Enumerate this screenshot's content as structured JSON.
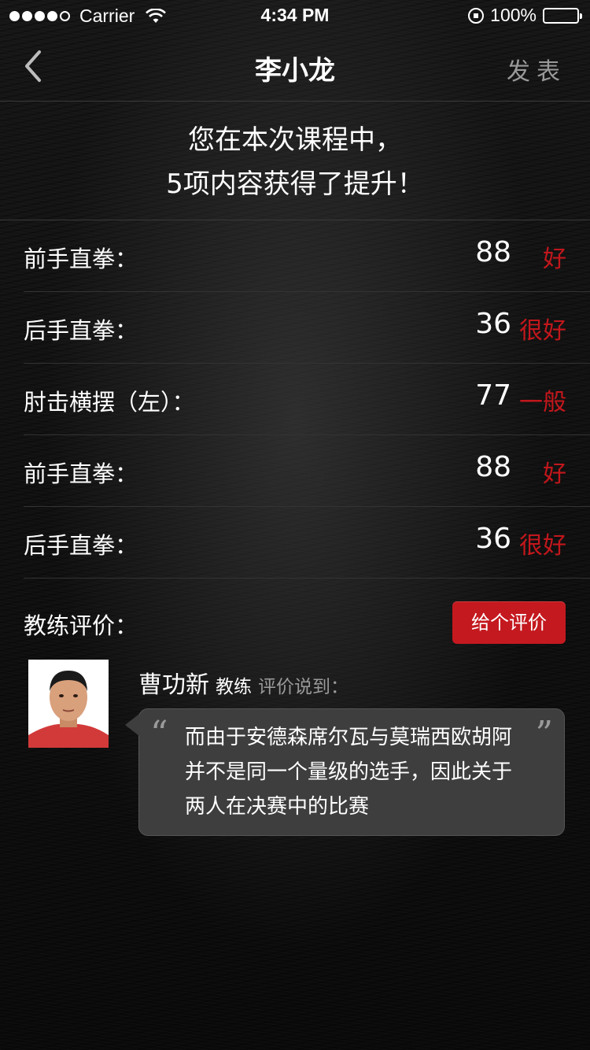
{
  "status_bar": {
    "carrier": "Carrier",
    "time": "4:34 PM",
    "battery": "100%"
  },
  "nav": {
    "title": "李小龙",
    "publish_label": "发表"
  },
  "summary": {
    "line1": "您在本次课程中，",
    "line2": "5项内容获得了提升！"
  },
  "scores": [
    {
      "label": "前手直拳：",
      "value": "88",
      "grade": "好"
    },
    {
      "label": "后手直拳：",
      "value": "36",
      "grade": "很好"
    },
    {
      "label": "肘击横摆（左）：",
      "value": "77",
      "grade": "一般"
    },
    {
      "label": "前手直拳：",
      "value": "88",
      "grade": "好"
    },
    {
      "label": "后手直拳：",
      "value": "36",
      "grade": "很好"
    }
  ],
  "coach_review": {
    "label": "教练评价：",
    "rate_button": "给个评价",
    "coach_name": "曹功新",
    "coach_role": "教练",
    "said_label": "评价说到：",
    "comment": "而由于安德森席尔瓦与莫瑞西欧胡阿并不是同一个量级的选手，因此关于两人在决赛中的比赛"
  },
  "colors": {
    "accent_red": "#c4191f",
    "grade_red": "#c2171c"
  }
}
